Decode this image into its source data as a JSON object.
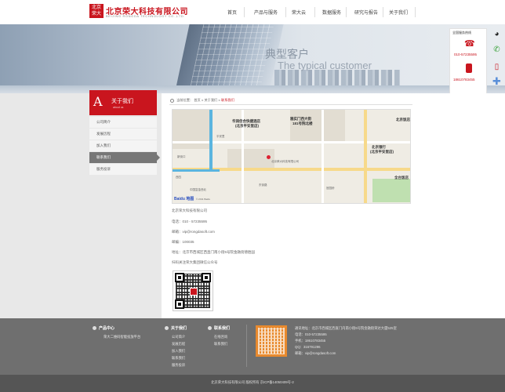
{
  "header": {
    "logo_box": "北京\n荣大",
    "logo_cn": "北京荣大科技有限公司",
    "logo_en": "BEIJING RONGDA TECHNOLOGY CO.,LTD.",
    "nav": [
      "首页",
      "产品与服务",
      "荣大云",
      "数据服务",
      "研究与报告",
      "关于我们"
    ]
  },
  "banner": {
    "title_cn": "典型客户",
    "title_en": "The typical customer"
  },
  "service": {
    "title": "全国服务热线",
    "phone": "010-57235595",
    "mobile": "18610783455"
  },
  "sidebar": {
    "letter": "A",
    "title": "关于我们",
    "subtitle": "about us",
    "items": [
      {
        "label": "公司简介",
        "active": false
      },
      {
        "label": "发展历程",
        "active": false
      },
      {
        "label": "加入我们",
        "active": false
      },
      {
        "label": "联系我们",
        "active": true
      },
      {
        "label": "服务投诉",
        "active": false
      }
    ]
  },
  "breadcrumb": {
    "prefix": "当前位置：",
    "items": [
      "首页",
      "关于我们"
    ],
    "current": "联系我们"
  },
  "map": {
    "labels": [
      "华润佳合快捷酒店",
      "(北京平安里店)",
      "雅实门西大街",
      "181号院北楼",
      "北京饭店",
      "北京银行",
      "(北京平安里店)",
      "全台饭店",
      "北京荣大科技有限公司"
    ],
    "smalls": [
      "平安里",
      "西四",
      "新街口",
      "中国富金西北",
      "东街路",
      "官园桥"
    ],
    "logo": "Baidu 地图",
    "copyright": "© 2011 Baidu"
  },
  "contact": {
    "company": "北京荣大科技有限公司",
    "phone": "电话：010 - 57235595",
    "email": "邮箱：vip@rongdasoft.com",
    "zip": "邮编：100035",
    "address": "地址：北京市西城区西直门南小街6号院金融街德胜园",
    "qr_caption": "扫码关注荣大集团微信公众号"
  },
  "footer": {
    "col1": {
      "title": "产品中心",
      "links": [
        "荣大二维码智能投放平台"
      ]
    },
    "col2": {
      "title": "关于我们",
      "links": [
        "公司简介",
        "发展历程",
        "加入我们",
        "联系我们",
        "服务投诉"
      ]
    },
    "col3": {
      "title": "联系我们",
      "links": [
        "在线咨询",
        "联系我们"
      ]
    },
    "info": [
      "通讯地址：北京市西城区西直门内南小街6号院金融街荣达大厦525室",
      "电话：010-57235595",
      "手机：18610783455",
      "QQ：316791296",
      "邮箱：vip@rongdasoft.com"
    ],
    "copyright": "北京荣大科技有限公司 版权所有  京ICP备14050409号-2"
  },
  "colors": {
    "brand": "#c9151e",
    "footer": "#6f6f6f"
  }
}
